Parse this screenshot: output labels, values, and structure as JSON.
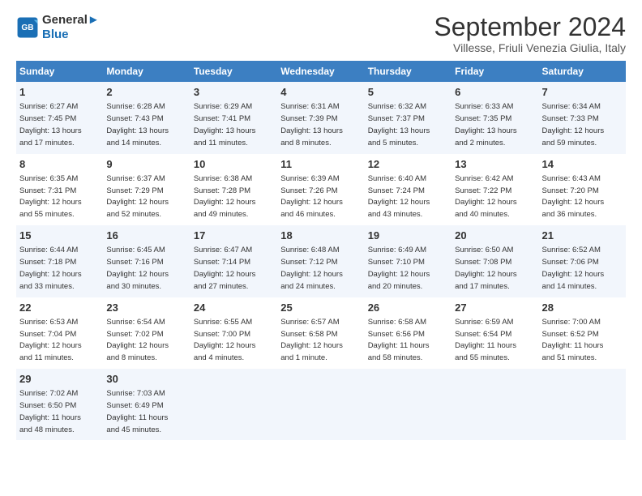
{
  "logo": {
    "line1": "General",
    "line2": "Blue"
  },
  "title": "September 2024",
  "subtitle": "Villesse, Friuli Venezia Giulia, Italy",
  "days_of_week": [
    "Sunday",
    "Monday",
    "Tuesday",
    "Wednesday",
    "Thursday",
    "Friday",
    "Saturday"
  ],
  "weeks": [
    [
      {
        "day": "1",
        "info": "Sunrise: 6:27 AM\nSunset: 7:45 PM\nDaylight: 13 hours\nand 17 minutes."
      },
      {
        "day": "2",
        "info": "Sunrise: 6:28 AM\nSunset: 7:43 PM\nDaylight: 13 hours\nand 14 minutes."
      },
      {
        "day": "3",
        "info": "Sunrise: 6:29 AM\nSunset: 7:41 PM\nDaylight: 13 hours\nand 11 minutes."
      },
      {
        "day": "4",
        "info": "Sunrise: 6:31 AM\nSunset: 7:39 PM\nDaylight: 13 hours\nand 8 minutes."
      },
      {
        "day": "5",
        "info": "Sunrise: 6:32 AM\nSunset: 7:37 PM\nDaylight: 13 hours\nand 5 minutes."
      },
      {
        "day": "6",
        "info": "Sunrise: 6:33 AM\nSunset: 7:35 PM\nDaylight: 13 hours\nand 2 minutes."
      },
      {
        "day": "7",
        "info": "Sunrise: 6:34 AM\nSunset: 7:33 PM\nDaylight: 12 hours\nand 59 minutes."
      }
    ],
    [
      {
        "day": "8",
        "info": "Sunrise: 6:35 AM\nSunset: 7:31 PM\nDaylight: 12 hours\nand 55 minutes."
      },
      {
        "day": "9",
        "info": "Sunrise: 6:37 AM\nSunset: 7:29 PM\nDaylight: 12 hours\nand 52 minutes."
      },
      {
        "day": "10",
        "info": "Sunrise: 6:38 AM\nSunset: 7:28 PM\nDaylight: 12 hours\nand 49 minutes."
      },
      {
        "day": "11",
        "info": "Sunrise: 6:39 AM\nSunset: 7:26 PM\nDaylight: 12 hours\nand 46 minutes."
      },
      {
        "day": "12",
        "info": "Sunrise: 6:40 AM\nSunset: 7:24 PM\nDaylight: 12 hours\nand 43 minutes."
      },
      {
        "day": "13",
        "info": "Sunrise: 6:42 AM\nSunset: 7:22 PM\nDaylight: 12 hours\nand 40 minutes."
      },
      {
        "day": "14",
        "info": "Sunrise: 6:43 AM\nSunset: 7:20 PM\nDaylight: 12 hours\nand 36 minutes."
      }
    ],
    [
      {
        "day": "15",
        "info": "Sunrise: 6:44 AM\nSunset: 7:18 PM\nDaylight: 12 hours\nand 33 minutes."
      },
      {
        "day": "16",
        "info": "Sunrise: 6:45 AM\nSunset: 7:16 PM\nDaylight: 12 hours\nand 30 minutes."
      },
      {
        "day": "17",
        "info": "Sunrise: 6:47 AM\nSunset: 7:14 PM\nDaylight: 12 hours\nand 27 minutes."
      },
      {
        "day": "18",
        "info": "Sunrise: 6:48 AM\nSunset: 7:12 PM\nDaylight: 12 hours\nand 24 minutes."
      },
      {
        "day": "19",
        "info": "Sunrise: 6:49 AM\nSunset: 7:10 PM\nDaylight: 12 hours\nand 20 minutes."
      },
      {
        "day": "20",
        "info": "Sunrise: 6:50 AM\nSunset: 7:08 PM\nDaylight: 12 hours\nand 17 minutes."
      },
      {
        "day": "21",
        "info": "Sunrise: 6:52 AM\nSunset: 7:06 PM\nDaylight: 12 hours\nand 14 minutes."
      }
    ],
    [
      {
        "day": "22",
        "info": "Sunrise: 6:53 AM\nSunset: 7:04 PM\nDaylight: 12 hours\nand 11 minutes."
      },
      {
        "day": "23",
        "info": "Sunrise: 6:54 AM\nSunset: 7:02 PM\nDaylight: 12 hours\nand 8 minutes."
      },
      {
        "day": "24",
        "info": "Sunrise: 6:55 AM\nSunset: 7:00 PM\nDaylight: 12 hours\nand 4 minutes."
      },
      {
        "day": "25",
        "info": "Sunrise: 6:57 AM\nSunset: 6:58 PM\nDaylight: 12 hours\nand 1 minute."
      },
      {
        "day": "26",
        "info": "Sunrise: 6:58 AM\nSunset: 6:56 PM\nDaylight: 11 hours\nand 58 minutes."
      },
      {
        "day": "27",
        "info": "Sunrise: 6:59 AM\nSunset: 6:54 PM\nDaylight: 11 hours\nand 55 minutes."
      },
      {
        "day": "28",
        "info": "Sunrise: 7:00 AM\nSunset: 6:52 PM\nDaylight: 11 hours\nand 51 minutes."
      }
    ],
    [
      {
        "day": "29",
        "info": "Sunrise: 7:02 AM\nSunset: 6:50 PM\nDaylight: 11 hours\nand 48 minutes."
      },
      {
        "day": "30",
        "info": "Sunrise: 7:03 AM\nSunset: 6:49 PM\nDaylight: 11 hours\nand 45 minutes."
      },
      null,
      null,
      null,
      null,
      null
    ]
  ]
}
